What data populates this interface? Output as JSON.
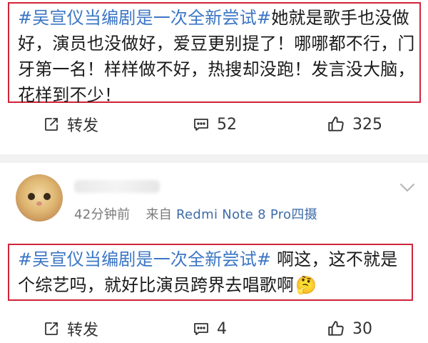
{
  "post1": {
    "hashtag": "#吴宣仪当编剧是一次全新尝试#",
    "text": "她就是歌手也没做好，演员也没做好，爱豆更别提了！哪哪都不行，门牙第一名！样样做不好，热搜却没跑！发言没大脑，花样到不少！",
    "actions": {
      "repost": "转发",
      "comments": "52",
      "likes": "325"
    }
  },
  "post2": {
    "time": "42分钟前",
    "source_prefix": "来自",
    "device": "Redmi Note 8 Pro四摄",
    "hashtag": "#吴宣仪当编剧是一次全新尝试#",
    "text": " 啊这，这不就是个综艺吗，就好比演员跨界去唱歌啊",
    "emoji": "🤔",
    "actions": {
      "repost": "转发",
      "comments": "4",
      "likes": "30"
    }
  },
  "colors": {
    "highlight_border": "#d0243a",
    "hashtag": "#3b76c4",
    "device_link": "#3e6ca8"
  },
  "icons": [
    "repost-icon",
    "comment-icon",
    "like-icon",
    "chevron-down-icon"
  ]
}
